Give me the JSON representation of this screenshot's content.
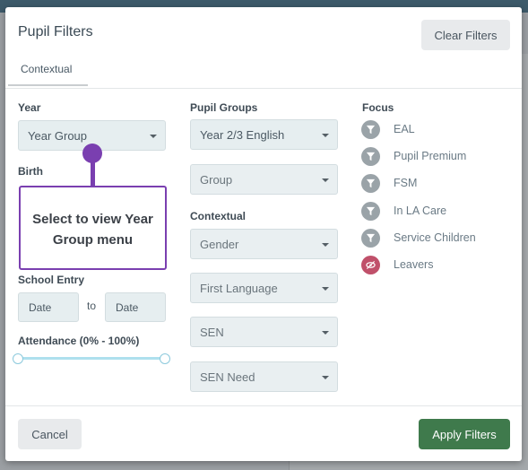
{
  "modal": {
    "title": "Pupil Filters",
    "clear_filters": "Clear Filters",
    "tab": "Contextual"
  },
  "year": {
    "label": "Year",
    "year_group": "Year Group"
  },
  "birth": {
    "label": "Birth"
  },
  "tooltip": {
    "text": "Select to view Year Group menu"
  },
  "school_entry": {
    "label": "School Entry",
    "from": "Date",
    "to_label": "to",
    "to": "Date"
  },
  "attendance": {
    "label": "Attendance (0% - 100%)",
    "min": 0,
    "max": 100
  },
  "pupil_groups": {
    "label": "Pupil Groups",
    "selected": "Year 2/3 English",
    "group": "Group"
  },
  "contextual": {
    "label": "Contextual",
    "gender": "Gender",
    "first_language": "First Language",
    "sen": "SEN",
    "sen_need": "SEN Need"
  },
  "focus": {
    "label": "Focus",
    "items": [
      {
        "label": "EAL",
        "icon": "filter-icon",
        "color": "#9aa3a8"
      },
      {
        "label": "Pupil Premium",
        "icon": "filter-icon",
        "color": "#9aa3a8"
      },
      {
        "label": "FSM",
        "icon": "filter-icon",
        "color": "#9aa3a8"
      },
      {
        "label": "In LA Care",
        "icon": "filter-icon",
        "color": "#9aa3a8"
      },
      {
        "label": "Service Children",
        "icon": "filter-icon",
        "color": "#9aa3a8"
      },
      {
        "label": "Leavers",
        "icon": "eye-slash-icon",
        "color": "#c0506a"
      }
    ]
  },
  "footer": {
    "cancel": "Cancel",
    "apply": "Apply Filters"
  },
  "colors": {
    "accent_purple": "#7a3fb0",
    "apply_green": "#3f7a4c"
  }
}
